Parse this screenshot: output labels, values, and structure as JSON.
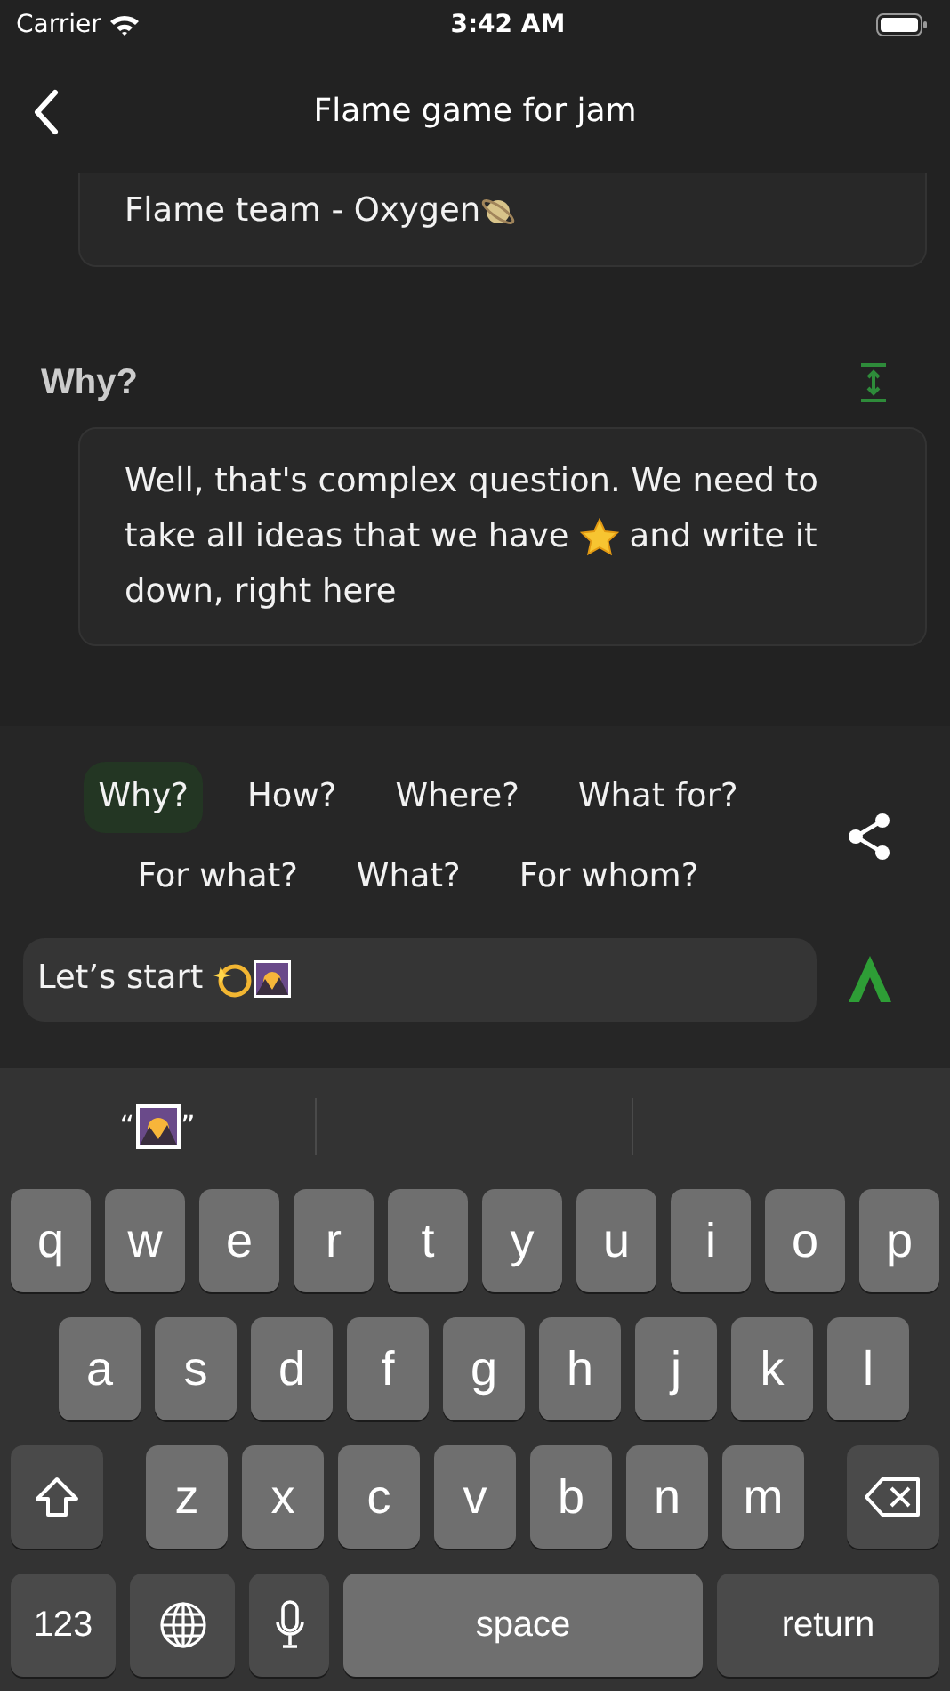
{
  "status_bar": {
    "carrier": "Carrier",
    "time": "3:42 AM"
  },
  "nav": {
    "title": "Flame game for jam"
  },
  "previous_card": {
    "text": "Flame team - Oxygen"
  },
  "section": {
    "heading": "Why?",
    "answer_lines": [
      {
        "before": "Well, that's complex question. We need to"
      },
      {
        "before": "take all ideas that we have",
        "star": true,
        "after": "and write it"
      },
      {
        "before": "down, right here"
      }
    ]
  },
  "chips": [
    {
      "label": "Why?",
      "selected": true
    },
    {
      "label": "How?",
      "selected": false
    },
    {
      "label": "Where?",
      "selected": false
    },
    {
      "label": "What for?",
      "selected": false
    },
    {
      "label": "For what?",
      "selected": false
    },
    {
      "label": "What?",
      "selected": false
    },
    {
      "label": "For whom?",
      "selected": false
    }
  ],
  "input": {
    "value": "Let’s start"
  },
  "suggestion": {
    "open_quote": "“",
    "close_quote": "”"
  },
  "keyboard": [
    [
      {
        "kind": "letter",
        "label": "q"
      },
      {
        "kind": "letter",
        "label": "w"
      },
      {
        "kind": "letter",
        "label": "e"
      },
      {
        "kind": "letter",
        "label": "r"
      },
      {
        "kind": "letter",
        "label": "t"
      },
      {
        "kind": "letter",
        "label": "y"
      },
      {
        "kind": "letter",
        "label": "u"
      },
      {
        "kind": "letter",
        "label": "i"
      },
      {
        "kind": "letter",
        "label": "o"
      },
      {
        "kind": "letter",
        "label": "p"
      }
    ],
    [
      {
        "kind": "letter",
        "label": "a"
      },
      {
        "kind": "letter",
        "label": "s"
      },
      {
        "kind": "letter",
        "label": "d"
      },
      {
        "kind": "letter",
        "label": "f"
      },
      {
        "kind": "letter",
        "label": "g"
      },
      {
        "kind": "letter",
        "label": "h"
      },
      {
        "kind": "letter",
        "label": "j"
      },
      {
        "kind": "letter",
        "label": "k"
      },
      {
        "kind": "letter",
        "label": "l"
      }
    ],
    [
      {
        "kind": "shift"
      },
      {
        "kind": "letter",
        "label": "z"
      },
      {
        "kind": "letter",
        "label": "x"
      },
      {
        "kind": "letter",
        "label": "c"
      },
      {
        "kind": "letter",
        "label": "v"
      },
      {
        "kind": "letter",
        "label": "b"
      },
      {
        "kind": "letter",
        "label": "n"
      },
      {
        "kind": "letter",
        "label": "m"
      },
      {
        "kind": "delete"
      }
    ],
    [
      {
        "kind": "numbers",
        "label": "123"
      },
      {
        "kind": "globe"
      },
      {
        "kind": "mic"
      },
      {
        "kind": "space",
        "label": "space"
      },
      {
        "kind": "return",
        "label": "return"
      }
    ]
  ]
}
